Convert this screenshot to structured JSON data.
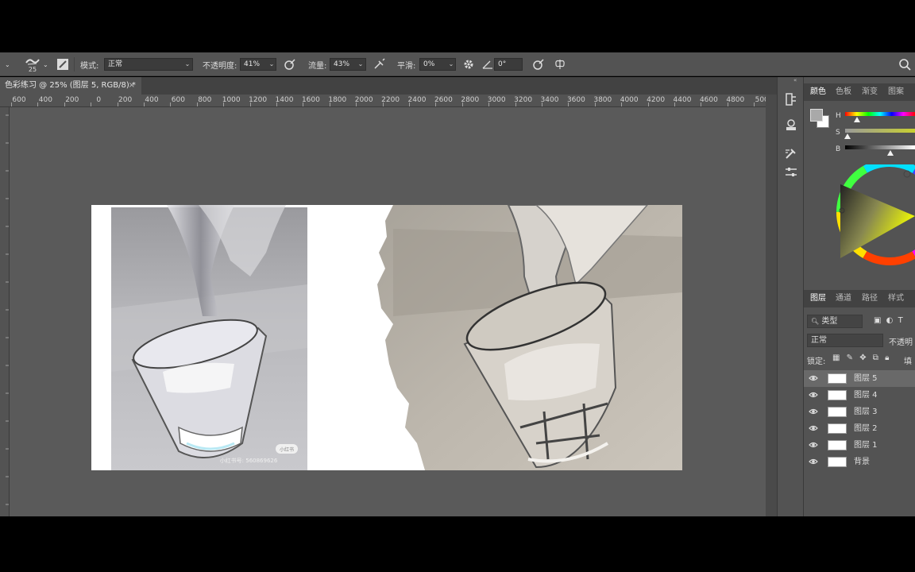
{
  "options_bar": {
    "brush_size": "25",
    "mode_label": "模式:",
    "mode_value": "正常",
    "opacity_label": "不透明度:",
    "opacity_value": "41%",
    "flow_label": "流量:",
    "flow_value": "43%",
    "smoothing_label": "平滑:",
    "smoothing_value": "0%",
    "angle_value": "0°"
  },
  "document": {
    "tab_title": "色彩练习 @ 25% (图层 5, RGB/8) *",
    "tab_close": "×"
  },
  "ruler": {
    "labels": [
      "600",
      "400",
      "200",
      "0",
      "200",
      "400",
      "600",
      "800",
      "1000",
      "1200",
      "1400",
      "1600",
      "1800",
      "2000",
      "2200",
      "2400",
      "2600",
      "2800",
      "3000",
      "3200",
      "3400",
      "3600",
      "3800",
      "4000",
      "4200",
      "4400",
      "4600",
      "4800",
      "500"
    ]
  },
  "artwork": {
    "photo_badge": "小红书",
    "photo_watermark": "小红书号: 560869626"
  },
  "color_panel": {
    "tabs": [
      "颜色",
      "色板",
      "渐变",
      "图案"
    ],
    "h_label": "H",
    "s_label": "S",
    "b_label": "B",
    "foreground_color": "#a9a9a9",
    "background_color": "#ffffff"
  },
  "layers_panel": {
    "tabs": [
      "图层",
      "通道",
      "路径",
      "样式"
    ],
    "filter_label": "类型",
    "blend_mode": "正常",
    "opacity_label": "不透明",
    "lock_label": "锁定:",
    "fill_label": "填",
    "layers": [
      {
        "name": "图层 5",
        "selected": true
      },
      {
        "name": "图层 4",
        "selected": false
      },
      {
        "name": "图层 3",
        "selected": false
      },
      {
        "name": "图层 2",
        "selected": false
      },
      {
        "name": "图层 1",
        "selected": false
      },
      {
        "name": "背景",
        "selected": false
      }
    ]
  },
  "colors": {
    "ui_dark": "#535353",
    "canvas_bg": "#5a5a5a",
    "selected_row": "#696969"
  }
}
